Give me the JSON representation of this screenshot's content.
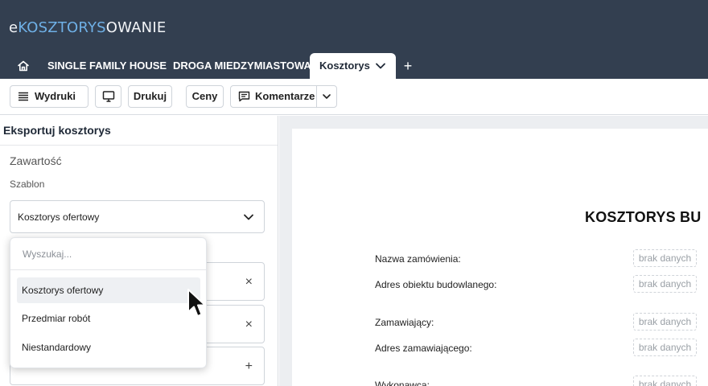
{
  "app": {
    "logo_prefix": "e",
    "logo_accent": "KOSZTORYS",
    "logo_suffix": "OWANIE",
    "accent_color": "#6fb0e6",
    "header_color": "#333f50"
  },
  "tabs": {
    "home_icon": "home-icon",
    "items": [
      {
        "label": "SINGLE FAMILY HOUSE"
      },
      {
        "label": "DROGA MIEDZYMIASTOWA"
      },
      {
        "label": "Kosztorys"
      }
    ],
    "add_label": "+"
  },
  "toolbar": {
    "wydruki": "Wydruki",
    "monitor_icon": "monitor-icon",
    "drukuj": "Drukuj",
    "ceny": "Ceny",
    "komentarze": "Komentarze"
  },
  "export_panel": {
    "title": "Eksportuj kosztorys",
    "section": "Zawartość",
    "template_label": "Szablon",
    "template_value": "Kosztorys ofertowy",
    "dropdown": {
      "search_placeholder": "Wyszukaj...",
      "options": [
        "Kosztorys ofertowy",
        "Przedmiar robót",
        "Niestandardowy"
      ]
    },
    "row_icons": [
      "×",
      "×",
      "+"
    ]
  },
  "preview": {
    "title": "KOSZTORYS BU",
    "rows": [
      {
        "label": "Nazwa zamówienia:",
        "value": "brak danych"
      },
      {
        "label": "Adres obiektu budowlanego:",
        "value": "brak danych"
      },
      {
        "label": "Zamawiający:",
        "value": "brak danych"
      },
      {
        "label": "Adres zamawiającego:",
        "value": "brak danych"
      },
      {
        "label": "Wykonawca:",
        "value": "brak danych"
      }
    ]
  }
}
